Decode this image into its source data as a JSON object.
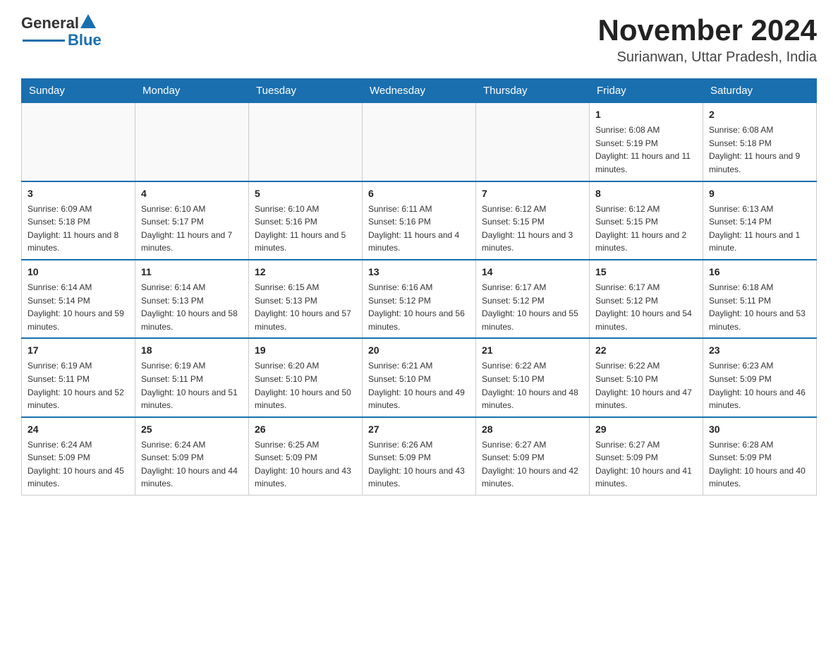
{
  "logo": {
    "general": "General",
    "blue": "Blue"
  },
  "title": "November 2024",
  "subtitle": "Surianwan, Uttar Pradesh, India",
  "days_of_week": [
    "Sunday",
    "Monday",
    "Tuesday",
    "Wednesday",
    "Thursday",
    "Friday",
    "Saturday"
  ],
  "weeks": [
    [
      {
        "day": "",
        "info": ""
      },
      {
        "day": "",
        "info": ""
      },
      {
        "day": "",
        "info": ""
      },
      {
        "day": "",
        "info": ""
      },
      {
        "day": "",
        "info": ""
      },
      {
        "day": "1",
        "info": "Sunrise: 6:08 AM\nSunset: 5:19 PM\nDaylight: 11 hours and 11 minutes."
      },
      {
        "day": "2",
        "info": "Sunrise: 6:08 AM\nSunset: 5:18 PM\nDaylight: 11 hours and 9 minutes."
      }
    ],
    [
      {
        "day": "3",
        "info": "Sunrise: 6:09 AM\nSunset: 5:18 PM\nDaylight: 11 hours and 8 minutes."
      },
      {
        "day": "4",
        "info": "Sunrise: 6:10 AM\nSunset: 5:17 PM\nDaylight: 11 hours and 7 minutes."
      },
      {
        "day": "5",
        "info": "Sunrise: 6:10 AM\nSunset: 5:16 PM\nDaylight: 11 hours and 5 minutes."
      },
      {
        "day": "6",
        "info": "Sunrise: 6:11 AM\nSunset: 5:16 PM\nDaylight: 11 hours and 4 minutes."
      },
      {
        "day": "7",
        "info": "Sunrise: 6:12 AM\nSunset: 5:15 PM\nDaylight: 11 hours and 3 minutes."
      },
      {
        "day": "8",
        "info": "Sunrise: 6:12 AM\nSunset: 5:15 PM\nDaylight: 11 hours and 2 minutes."
      },
      {
        "day": "9",
        "info": "Sunrise: 6:13 AM\nSunset: 5:14 PM\nDaylight: 11 hours and 1 minute."
      }
    ],
    [
      {
        "day": "10",
        "info": "Sunrise: 6:14 AM\nSunset: 5:14 PM\nDaylight: 10 hours and 59 minutes."
      },
      {
        "day": "11",
        "info": "Sunrise: 6:14 AM\nSunset: 5:13 PM\nDaylight: 10 hours and 58 minutes."
      },
      {
        "day": "12",
        "info": "Sunrise: 6:15 AM\nSunset: 5:13 PM\nDaylight: 10 hours and 57 minutes."
      },
      {
        "day": "13",
        "info": "Sunrise: 6:16 AM\nSunset: 5:12 PM\nDaylight: 10 hours and 56 minutes."
      },
      {
        "day": "14",
        "info": "Sunrise: 6:17 AM\nSunset: 5:12 PM\nDaylight: 10 hours and 55 minutes."
      },
      {
        "day": "15",
        "info": "Sunrise: 6:17 AM\nSunset: 5:12 PM\nDaylight: 10 hours and 54 minutes."
      },
      {
        "day": "16",
        "info": "Sunrise: 6:18 AM\nSunset: 5:11 PM\nDaylight: 10 hours and 53 minutes."
      }
    ],
    [
      {
        "day": "17",
        "info": "Sunrise: 6:19 AM\nSunset: 5:11 PM\nDaylight: 10 hours and 52 minutes."
      },
      {
        "day": "18",
        "info": "Sunrise: 6:19 AM\nSunset: 5:11 PM\nDaylight: 10 hours and 51 minutes."
      },
      {
        "day": "19",
        "info": "Sunrise: 6:20 AM\nSunset: 5:10 PM\nDaylight: 10 hours and 50 minutes."
      },
      {
        "day": "20",
        "info": "Sunrise: 6:21 AM\nSunset: 5:10 PM\nDaylight: 10 hours and 49 minutes."
      },
      {
        "day": "21",
        "info": "Sunrise: 6:22 AM\nSunset: 5:10 PM\nDaylight: 10 hours and 48 minutes."
      },
      {
        "day": "22",
        "info": "Sunrise: 6:22 AM\nSunset: 5:10 PM\nDaylight: 10 hours and 47 minutes."
      },
      {
        "day": "23",
        "info": "Sunrise: 6:23 AM\nSunset: 5:09 PM\nDaylight: 10 hours and 46 minutes."
      }
    ],
    [
      {
        "day": "24",
        "info": "Sunrise: 6:24 AM\nSunset: 5:09 PM\nDaylight: 10 hours and 45 minutes."
      },
      {
        "day": "25",
        "info": "Sunrise: 6:24 AM\nSunset: 5:09 PM\nDaylight: 10 hours and 44 minutes."
      },
      {
        "day": "26",
        "info": "Sunrise: 6:25 AM\nSunset: 5:09 PM\nDaylight: 10 hours and 43 minutes."
      },
      {
        "day": "27",
        "info": "Sunrise: 6:26 AM\nSunset: 5:09 PM\nDaylight: 10 hours and 43 minutes."
      },
      {
        "day": "28",
        "info": "Sunrise: 6:27 AM\nSunset: 5:09 PM\nDaylight: 10 hours and 42 minutes."
      },
      {
        "day": "29",
        "info": "Sunrise: 6:27 AM\nSunset: 5:09 PM\nDaylight: 10 hours and 41 minutes."
      },
      {
        "day": "30",
        "info": "Sunrise: 6:28 AM\nSunset: 5:09 PM\nDaylight: 10 hours and 40 minutes."
      }
    ]
  ]
}
